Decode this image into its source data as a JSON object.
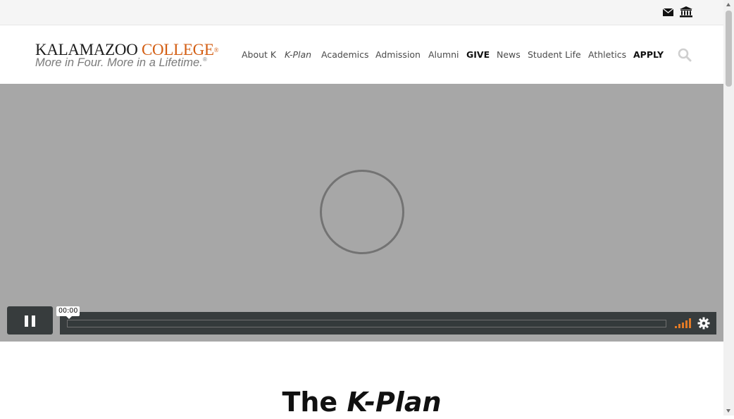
{
  "utility": {
    "icons": [
      "envelope-icon",
      "institution-icon"
    ]
  },
  "logo": {
    "name_part1": "KALAMAZOO",
    "name_part2": "COLLEGE",
    "registered": "®",
    "tagline": "More in Four. More in a Lifetime.",
    "tagline_mark": "®"
  },
  "nav": {
    "items": [
      {
        "label": "About K"
      },
      {
        "label": "K-Plan"
      },
      {
        "label": "Academics"
      },
      {
        "label": "Admission"
      },
      {
        "label": "Alumni"
      },
      {
        "label": "GIVE"
      },
      {
        "label": "News"
      },
      {
        "label": "Student Life"
      },
      {
        "label": "Athletics"
      },
      {
        "label": "APPLY"
      }
    ]
  },
  "video": {
    "current_time": "00:00",
    "progress": 0,
    "volume_level": 1.0
  },
  "page": {
    "title_prefix": "The",
    "title_em": "K-Plan"
  },
  "colors": {
    "brand_orange": "#d35e13",
    "video_bg": "#a7a7a7",
    "controls_bg": "#2e3435",
    "volume": "#e8771c"
  }
}
